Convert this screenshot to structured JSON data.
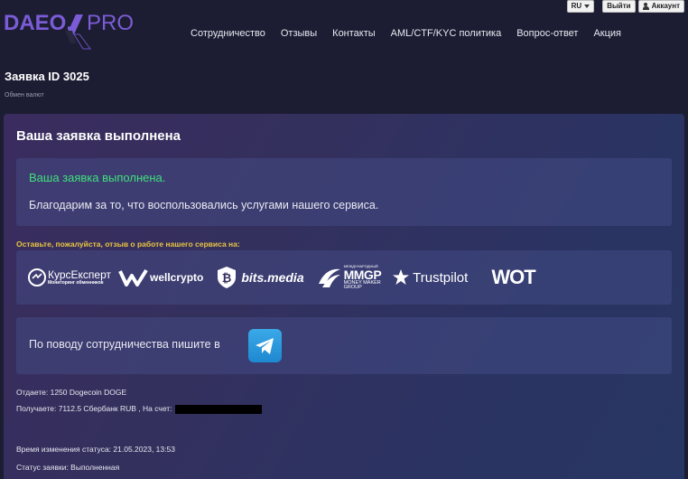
{
  "brand": {
    "name_left": "DAEO.",
    "name_right": "PRO"
  },
  "nav": [
    "Сотрудничество",
    "Отзывы",
    "Контакты",
    "AML/CTF/KYC политика",
    "Вопрос-ответ",
    "Акция"
  ],
  "topbar": {
    "lang": "RU",
    "logout": "Выйти",
    "account": "Аккаунт"
  },
  "page": {
    "title": "Заявка ID 3025",
    "breadcrumb": "Обмен валют"
  },
  "panel": {
    "title": "Ваша заявка выполнена",
    "success_text": "Ваша заявка выполнена.",
    "thanks_text": "Благодарим за то, что воспользовались услугами нашего сервиса.",
    "review_prompt": "Оставьте, пожалуйста, отзыв о работе нашего сервиса на:",
    "review_sites": {
      "kurs_main": "КурсЕксперт",
      "kurs_sub": "Мониторинг обменников",
      "wellcrypto": "wellcrypto",
      "bits": "bits.media",
      "mmgp_small": "МЕЖДУНАРОДНЫЙ",
      "mmgp": "MMGP",
      "mmgp_sub1": "MONEY MAKER",
      "mmgp_sub2": "GROUP",
      "trustpilot": "Trustpilot",
      "wot": "WOT"
    },
    "coop_text": "По поводу сотрудничества пишите в"
  },
  "order": {
    "give": "Отдаете: 1250 Dogecoin DOGE",
    "receive": "Получаете: 7112.5 Сбербанк RUB , На счет:",
    "status_time": "Время изменения статуса: 21.05.2023, 13:53",
    "status": "Статус заявки: Выполненная"
  }
}
